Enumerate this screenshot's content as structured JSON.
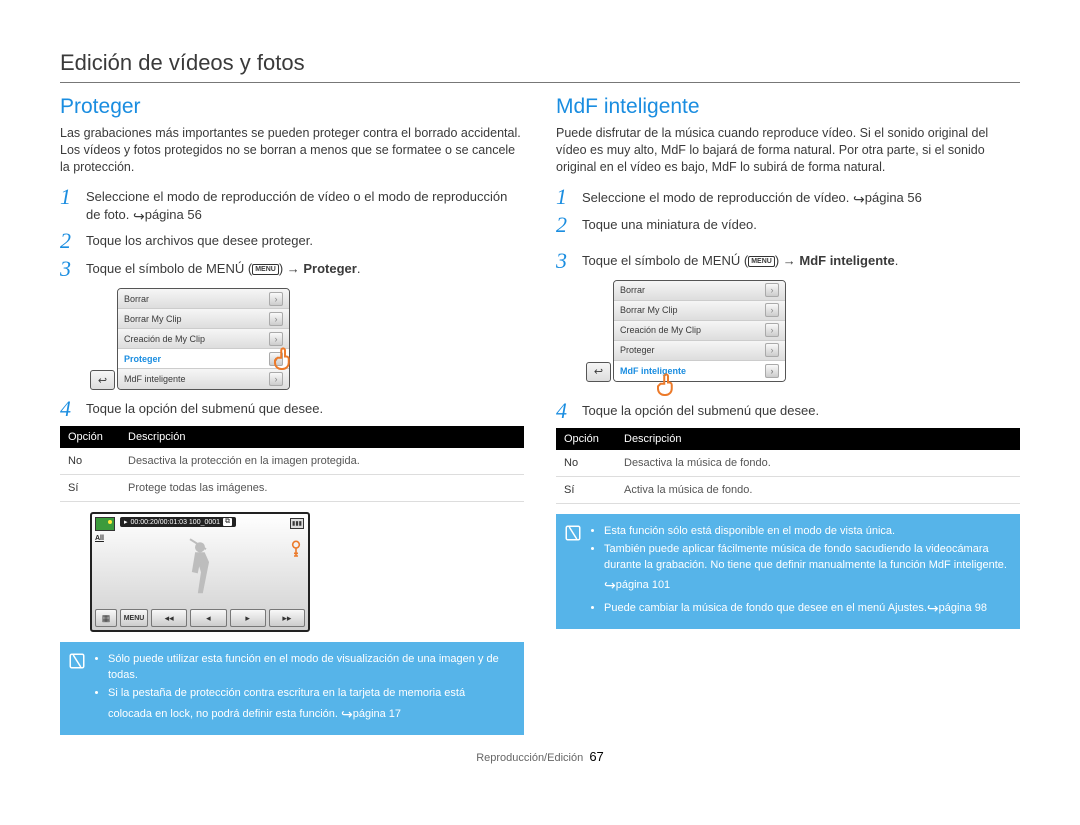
{
  "page_title": "Edición de vídeos y fotos",
  "footer": {
    "section": "Reproducción/Edición",
    "page_num": "67"
  },
  "left": {
    "heading": "Proteger",
    "intro": "Las grabaciones más importantes se pueden proteger contra el borrado accidental. Los vídeos y fotos protegidos no se borran a menos que se formatee o se cancele la protección.",
    "steps": {
      "s1": "Seleccione el modo de reproducción de vídeo o el modo de reproducción de foto. ",
      "s1_ref": "página 56",
      "s2": "Toque los archivos que desee proteger.",
      "s3_a": "Toque el símbolo de MENÚ (",
      "s3_chip": "MENU",
      "s3_b": ") → ",
      "s3_bold": "Proteger",
      "s3_c": ".",
      "s4": "Toque la opción del submenú que desee."
    },
    "menu": {
      "items": [
        "Borrar",
        "Borrar My Clip",
        "Creación de My Clip",
        "Proteger",
        "MdF inteligente"
      ],
      "active_index": 3,
      "back": "↩"
    },
    "table": {
      "h1": "Opción",
      "h2": "Descripción",
      "r1c1": "No",
      "r1c2": "Desactiva la protección en la imagen protegida.",
      "r2c1": "Sí",
      "r2c2": "Protege todas las imágenes."
    },
    "preview": {
      "time": "00:00:20/00:01:03   100_0001",
      "all": "All",
      "menu_label": "MENU"
    },
    "note": {
      "bullets": [
        "Sólo puede utilizar esta función en el modo de visualización de una imagen y de todas.",
        "Si la pestaña de protección contra escritura en la tarjeta de memoria está colocada en lock, no podrá definir esta función. "
      ],
      "ref": "página 17"
    }
  },
  "right": {
    "heading": "MdF inteligente",
    "intro": "Puede disfrutar de la música cuando reproduce vídeo. Si el sonido original del vídeo es muy alto, MdF lo bajará de forma natural. Por otra parte, si el sonido original en el vídeo es bajo, MdF lo subirá de forma natural.",
    "steps": {
      "s1": "Seleccione el modo de reproducción de vídeo. ",
      "s1_ref": "página 56",
      "s2": "Toque una miniatura de vídeo.",
      "s3_a": "Toque el símbolo de MENÚ (",
      "s3_chip": "MENU",
      "s3_b": ") → ",
      "s3_bold": "MdF inteligente",
      "s3_c": ".",
      "s4": "Toque la opción del submenú que desee."
    },
    "menu": {
      "items": [
        "Borrar",
        "Borrar My Clip",
        "Creación de My Clip",
        "Proteger",
        "MdF inteligente"
      ],
      "active_index": 4,
      "back": "↩"
    },
    "table": {
      "h1": "Opción",
      "h2": "Descripción",
      "r1c1": "No",
      "r1c2": "Desactiva la música de fondo.",
      "r2c1": "Sí",
      "r2c2": "Activa la música de fondo."
    },
    "note": {
      "bullets": [
        "Esta función sólo está disponible en el modo de vista única.",
        "También puede aplicar fácilmente música de fondo sacudiendo la videocámara durante la grabación. No tiene que definir manualmente la función MdF inteligente. ",
        "Puede cambiar la música de fondo que desee en el menú Ajustes."
      ],
      "ref1": "página 101",
      "ref2": "página 98"
    }
  }
}
